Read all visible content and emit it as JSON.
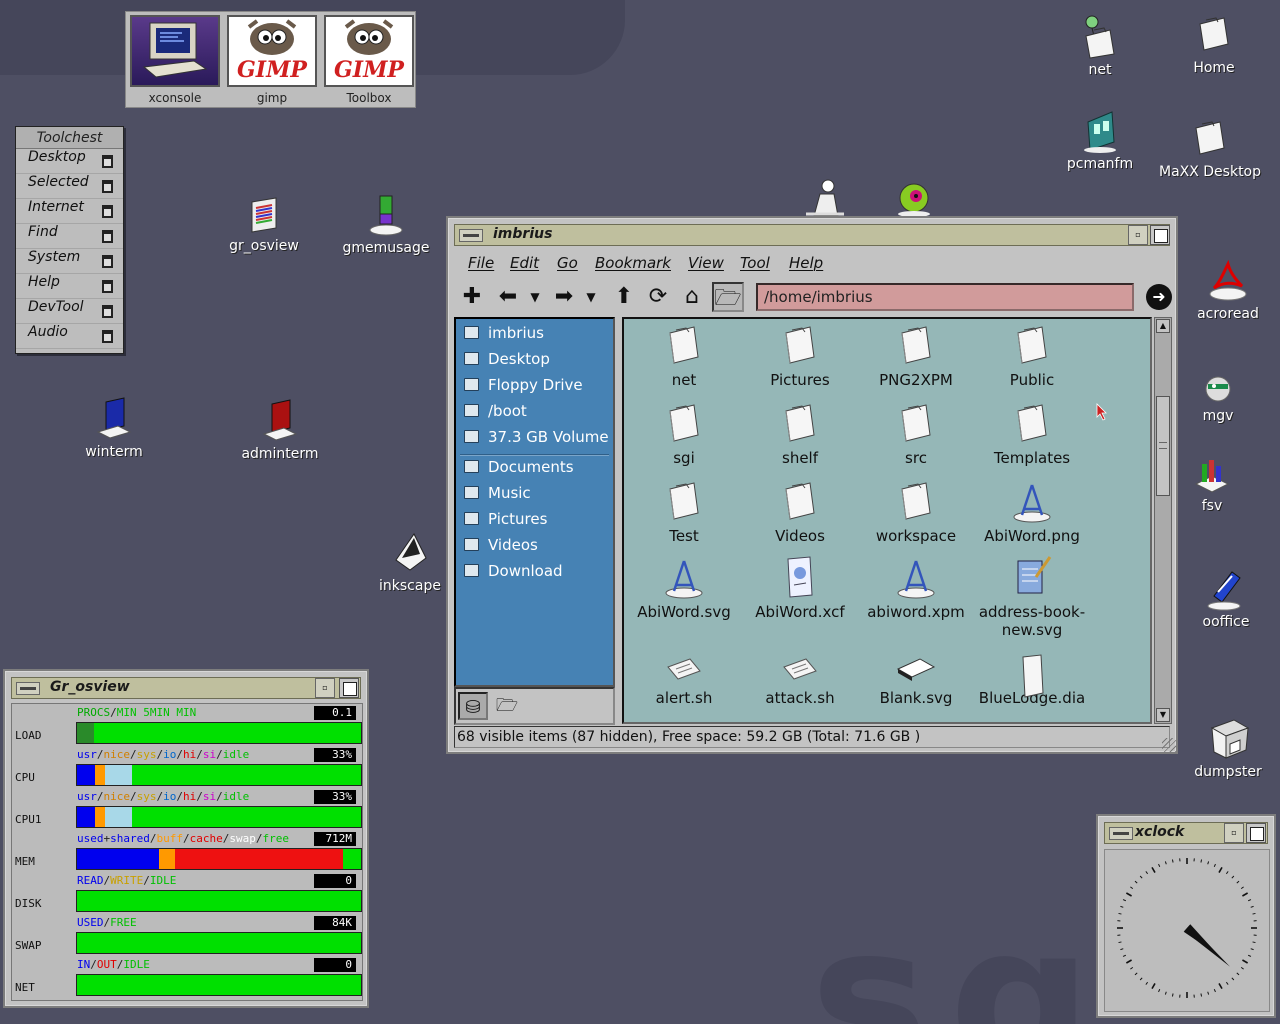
{
  "launcher": [
    {
      "label": "xconsole",
      "icon": "terminal-computer-icon"
    },
    {
      "label": "gimp",
      "icon": "gimp-wilber-icon"
    },
    {
      "label": "Toolbox",
      "icon": "gimp-wilber-icon"
    }
  ],
  "gimp_logo_text": "GIMP",
  "toolchest": {
    "title": "Toolchest",
    "items": [
      "Desktop",
      "Selected",
      "Internet",
      "Find",
      "System",
      "Help",
      "DevTool",
      "Audio"
    ]
  },
  "desktop_icons": {
    "net": "net",
    "home": "Home",
    "pcmanfm": "pcmanfm",
    "maxx_desktop": "MaXX Desktop",
    "gr_osview": "gr_osview",
    "gmemusage": "gmemusage",
    "winterm": "winterm",
    "adminterm": "adminterm",
    "inkscape": "inkscape",
    "acroread": "acroread",
    "mgv": "mgv",
    "fsv": "fsv",
    "ooffice": "ooffice",
    "dumpster": "dumpster"
  },
  "file_manager": {
    "title": "imbrius",
    "menu": [
      "File",
      "Edit",
      "Go",
      "Bookmark",
      "View",
      "Tool",
      "Help"
    ],
    "toolbar_icons": [
      "new-tab-icon",
      "back-icon",
      "back-history-icon",
      "forward-icon",
      "forward-history-icon",
      "up-icon",
      "reload-icon",
      "home-icon",
      "folder-view-icon"
    ],
    "address": "/home/imbrius",
    "sidebar_places": [
      {
        "label": "imbrius",
        "icon": "home-folder-icon"
      },
      {
        "label": "Desktop",
        "icon": "desktop-icon"
      },
      {
        "label": "Floppy Drive",
        "icon": "drive-icon"
      },
      {
        "label": "/boot",
        "icon": "usb-drive-icon"
      },
      {
        "label": "37.3 GB Volume",
        "icon": "drive-icon"
      }
    ],
    "sidebar_bookmarks": [
      {
        "label": "Documents",
        "icon": "folder-icon"
      },
      {
        "label": "Music",
        "icon": "folder-icon"
      },
      {
        "label": "Pictures",
        "icon": "folder-icon"
      },
      {
        "label": "Videos",
        "icon": "folder-icon"
      },
      {
        "label": "Download",
        "icon": "folder-icon"
      }
    ],
    "files": [
      {
        "name": "net",
        "type": "folder"
      },
      {
        "name": "Pictures",
        "type": "folder"
      },
      {
        "name": "PNG2XPM",
        "type": "folder"
      },
      {
        "name": "Public",
        "type": "folder"
      },
      {
        "name": "sgi",
        "type": "folder"
      },
      {
        "name": "shelf",
        "type": "folder"
      },
      {
        "name": "src",
        "type": "folder"
      },
      {
        "name": "Templates",
        "type": "folder"
      },
      {
        "name": "Test",
        "type": "folder"
      },
      {
        "name": "Videos",
        "type": "folder"
      },
      {
        "name": "workspace",
        "type": "folder"
      },
      {
        "name": "AbiWord.png",
        "type": "image"
      },
      {
        "name": "AbiWord.svg",
        "type": "image"
      },
      {
        "name": "AbiWord.xcf",
        "type": "xcf"
      },
      {
        "name": "abiword.xpm",
        "type": "image"
      },
      {
        "name": "address-book-\nnew.svg",
        "type": "addressbook"
      },
      {
        "name": "alert.sh",
        "type": "script"
      },
      {
        "name": "attack.sh",
        "type": "script"
      },
      {
        "name": "Blank.svg",
        "type": "blank"
      },
      {
        "name": "BlueLodge.dia",
        "type": "doc"
      }
    ],
    "status": "68 visible items (87 hidden), Free space: 59.2 GB (Total: 71.6 GB )"
  },
  "osview": {
    "title": "Gr_osview",
    "rows": [
      {
        "label": "LOAD",
        "legend": [
          {
            "t": "PROCS",
            "c": "#00aa00"
          },
          {
            "t": "/",
            "c": "#222"
          },
          {
            "t": "MIN",
            "c": "#00c000"
          },
          {
            "t": " ",
            "c": "#222"
          },
          {
            "t": "5MIN",
            "c": "#00c000"
          },
          {
            "t": " ",
            "c": "#222"
          },
          {
            "t": "MIN",
            "c": "#00c000"
          }
        ],
        "value": "0.1",
        "segments": [
          {
            "c": "#2a8a2a",
            "w": 6
          },
          {
            "c": "#00e000",
            "w": 94
          }
        ]
      },
      {
        "label": "CPU",
        "legend": [
          {
            "t": "usr",
            "c": "#0000ee"
          },
          {
            "t": "/",
            "c": "#222"
          },
          {
            "t": "nice",
            "c": "#d08000"
          },
          {
            "t": "/",
            "c": "#222"
          },
          {
            "t": "sys",
            "c": "#c8a000"
          },
          {
            "t": "/",
            "c": "#222"
          },
          {
            "t": "io",
            "c": "#0066cc"
          },
          {
            "t": "/",
            "c": "#222"
          },
          {
            "t": "hi",
            "c": "#e00000"
          },
          {
            "t": "/",
            "c": "#222"
          },
          {
            "t": "si",
            "c": "#cc00cc"
          },
          {
            "t": "/",
            "c": "#222"
          },
          {
            "t": "idle",
            "c": "#00c000"
          }
        ],
        "value": "33%",
        "segments": [
          {
            "c": "#0000ee",
            "w": 6.5
          },
          {
            "c": "#ff9900",
            "w": 3.5
          },
          {
            "c": "#a8d8e8",
            "w": 9.5
          },
          {
            "c": "#00e000",
            "w": 80.5
          }
        ]
      },
      {
        "label": "CPU1",
        "legend": [
          {
            "t": "usr",
            "c": "#0000ee"
          },
          {
            "t": "/",
            "c": "#222"
          },
          {
            "t": "nice",
            "c": "#d08000"
          },
          {
            "t": "/",
            "c": "#222"
          },
          {
            "t": "sys",
            "c": "#c8a000"
          },
          {
            "t": "/",
            "c": "#222"
          },
          {
            "t": "io",
            "c": "#0066cc"
          },
          {
            "t": "/",
            "c": "#222"
          },
          {
            "t": "hi",
            "c": "#e00000"
          },
          {
            "t": "/",
            "c": "#222"
          },
          {
            "t": "si",
            "c": "#cc00cc"
          },
          {
            "t": "/",
            "c": "#222"
          },
          {
            "t": "idle",
            "c": "#00c000"
          }
        ],
        "value": "33%",
        "segments": [
          {
            "c": "#0000ee",
            "w": 6.5
          },
          {
            "c": "#ff9900",
            "w": 3.5
          },
          {
            "c": "#a8d8e8",
            "w": 9.5
          },
          {
            "c": "#00e000",
            "w": 80.5
          }
        ]
      },
      {
        "label": "MEM",
        "legend": [
          {
            "t": "used",
            "c": "#0000ee"
          },
          {
            "t": "+",
            "c": "#222"
          },
          {
            "t": "shared",
            "c": "#0000ee"
          },
          {
            "t": "/",
            "c": "#222"
          },
          {
            "t": "buff",
            "c": "#ff9900"
          },
          {
            "t": "/",
            "c": "#222"
          },
          {
            "t": "cache",
            "c": "#e00000"
          },
          {
            "t": "/",
            "c": "#222"
          },
          {
            "t": "swap",
            "c": "#ffffff"
          },
          {
            "t": "/",
            "c": "#222"
          },
          {
            "t": "free",
            "c": "#00c000"
          }
        ],
        "value": "712M",
        "segments": [
          {
            "c": "#0000ee",
            "w": 29
          },
          {
            "c": "#ff9900",
            "w": 5.5
          },
          {
            "c": "#ee1111",
            "w": 59
          },
          {
            "c": "#00e000",
            "w": 6.5
          }
        ]
      },
      {
        "label": "DISK",
        "legend": [
          {
            "t": "READ",
            "c": "#0000ee"
          },
          {
            "t": "/",
            "c": "#222"
          },
          {
            "t": "WRITE",
            "c": "#c8a000"
          },
          {
            "t": "/",
            "c": "#222"
          },
          {
            "t": "IDLE",
            "c": "#00c000"
          }
        ],
        "value": "0",
        "segments": [
          {
            "c": "#00e000",
            "w": 100
          }
        ]
      },
      {
        "label": "SWAP",
        "legend": [
          {
            "t": "USED",
            "c": "#0000ee"
          },
          {
            "t": "/",
            "c": "#222"
          },
          {
            "t": "FREE",
            "c": "#00c000"
          }
        ],
        "value": "84K",
        "segments": [
          {
            "c": "#00e000",
            "w": 100
          }
        ]
      },
      {
        "label": "NET",
        "legend": [
          {
            "t": "IN",
            "c": "#0000ee"
          },
          {
            "t": "/",
            "c": "#222"
          },
          {
            "t": "OUT",
            "c": "#e00000"
          },
          {
            "t": "/",
            "c": "#222"
          },
          {
            "t": "IDLE",
            "c": "#00c000"
          }
        ],
        "value": "0",
        "segments": [
          {
            "c": "#00e000",
            "w": 100
          }
        ]
      }
    ]
  },
  "xclock": {
    "title": "xclock",
    "hour": 4,
    "minute": 22
  }
}
